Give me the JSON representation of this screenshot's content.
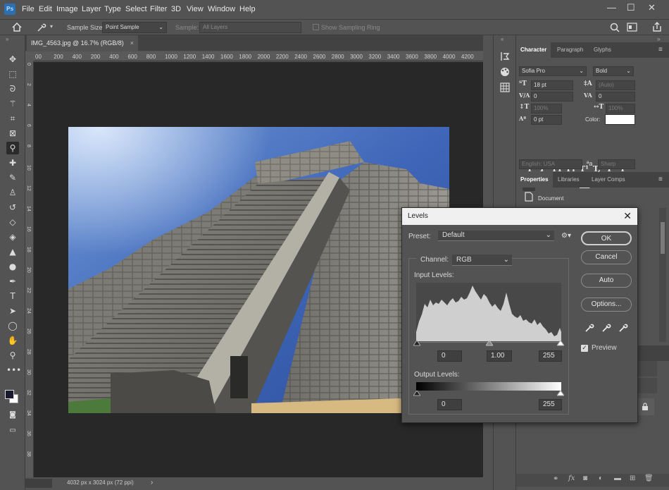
{
  "app": {
    "logo": "Ps"
  },
  "menu": [
    "File",
    "Edit",
    "Image",
    "Layer",
    "Type",
    "Select",
    "Filter",
    "3D",
    "View",
    "Window",
    "Help"
  ],
  "window_controls": {
    "minimize": "—",
    "restore": "☐",
    "close": "✕"
  },
  "options": {
    "sample_size_label": "Sample Size:",
    "sample_size_value": "Point Sample",
    "sample_label": "Sample:",
    "sample_value": "All Layers",
    "show_ring_label": "Show Sampling Ring"
  },
  "document": {
    "tab_title": "IMG_4563.jpg @ 16.7% (RGB/8)",
    "tab_close": "×",
    "status": "4032 px x 3024 px (72 ppi)"
  },
  "ruler": {
    "h": [
      "00",
      "200",
      "400",
      "200",
      "400",
      "600",
      "800",
      "1000",
      "1200",
      "1400",
      "1600",
      "1800",
      "2000",
      "2200",
      "2400",
      "2600",
      "2800",
      "3000",
      "3200",
      "3400",
      "3600",
      "3800",
      "4000",
      "4200"
    ],
    "v": [
      "0",
      "2",
      "4",
      "6",
      "8",
      "10",
      "12",
      "14",
      "16",
      "18",
      "20",
      "22",
      "24",
      "26",
      "28",
      "30",
      "32",
      "34",
      "36",
      "38"
    ]
  },
  "character": {
    "tabs": [
      "Character",
      "Paragraph",
      "Glyphs"
    ],
    "font_family": "Sofia Pro",
    "font_style": "Bold",
    "size": "18 pt",
    "leading": "(Auto)",
    "kerning": "0",
    "tracking": "0",
    "vscale": "100%",
    "hscale": "100%",
    "baseline": "0 pt",
    "color_label": "Color:",
    "style_buttons": [
      "T",
      "T",
      "TT",
      "Tт",
      "T¹",
      "T,",
      "T",
      "Ŧ"
    ],
    "opentype_buttons": [
      "fi",
      "ơ",
      "st",
      "A",
      "aa",
      "T",
      "1st",
      "½"
    ],
    "language": "English: USA",
    "aa_label": "ªa",
    "antialias": "Sharp"
  },
  "properties": {
    "tabs": [
      "Properties",
      "Libraries",
      "Layer Comps"
    ],
    "document_label": "Document"
  },
  "levels": {
    "title": "Levels",
    "close": "✕",
    "preset_label": "Preset:",
    "preset_value": "Default",
    "channel_label": "Channel:",
    "channel_value": "RGB",
    "input_label": "Input Levels:",
    "input_black": "0",
    "input_gamma": "1.00",
    "input_white": "255",
    "output_label": "Output Levels:",
    "output_black": "0",
    "output_white": "255",
    "buttons": {
      "ok": "OK",
      "cancel": "Cancel",
      "auto": "Auto",
      "options": "Options..."
    },
    "preview_label": "Preview",
    "preview_checked": true
  }
}
